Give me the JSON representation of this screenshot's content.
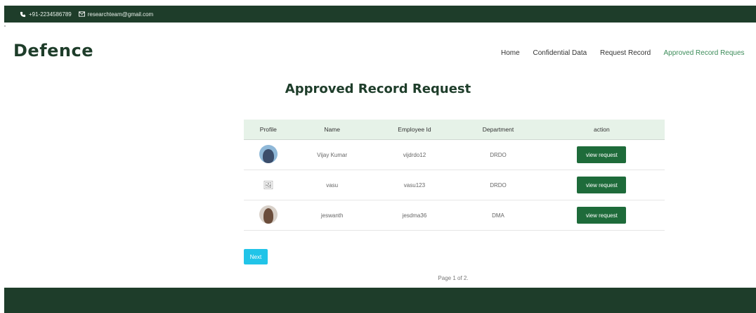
{
  "topbar": {
    "phone": "+91-2234586789",
    "email": "researchteam@gmail.com"
  },
  "brand": "Defence",
  "nav": {
    "home": "Home",
    "confidential": "Confidential Data",
    "request": "Request Record",
    "approved": "Approved Record Reques"
  },
  "page_title": "Approved Record Request",
  "table": {
    "headers": [
      "Profile",
      "Name",
      "Employee Id",
      "Department",
      "action"
    ],
    "rows": [
      {
        "name": "Vijay Kumar",
        "emp_id": "vijdrdo12",
        "dept": "DRDO",
        "action": "view request",
        "avatar": "profile-photo"
      },
      {
        "name": "vasu",
        "emp_id": "vasu123",
        "dept": "DRDO",
        "action": "view request",
        "avatar": "broken-image"
      },
      {
        "name": "jeswanth",
        "emp_id": "jesdma36",
        "dept": "DMA",
        "action": "view request",
        "avatar": "profile-photo"
      }
    ]
  },
  "next_label": "Next",
  "pager": "Page 1 of 2.",
  "colors": {
    "primary": "#1e3d2a",
    "accent": "#3d8c5a",
    "button": "#1e6b3a",
    "next": "#21c4e8"
  }
}
